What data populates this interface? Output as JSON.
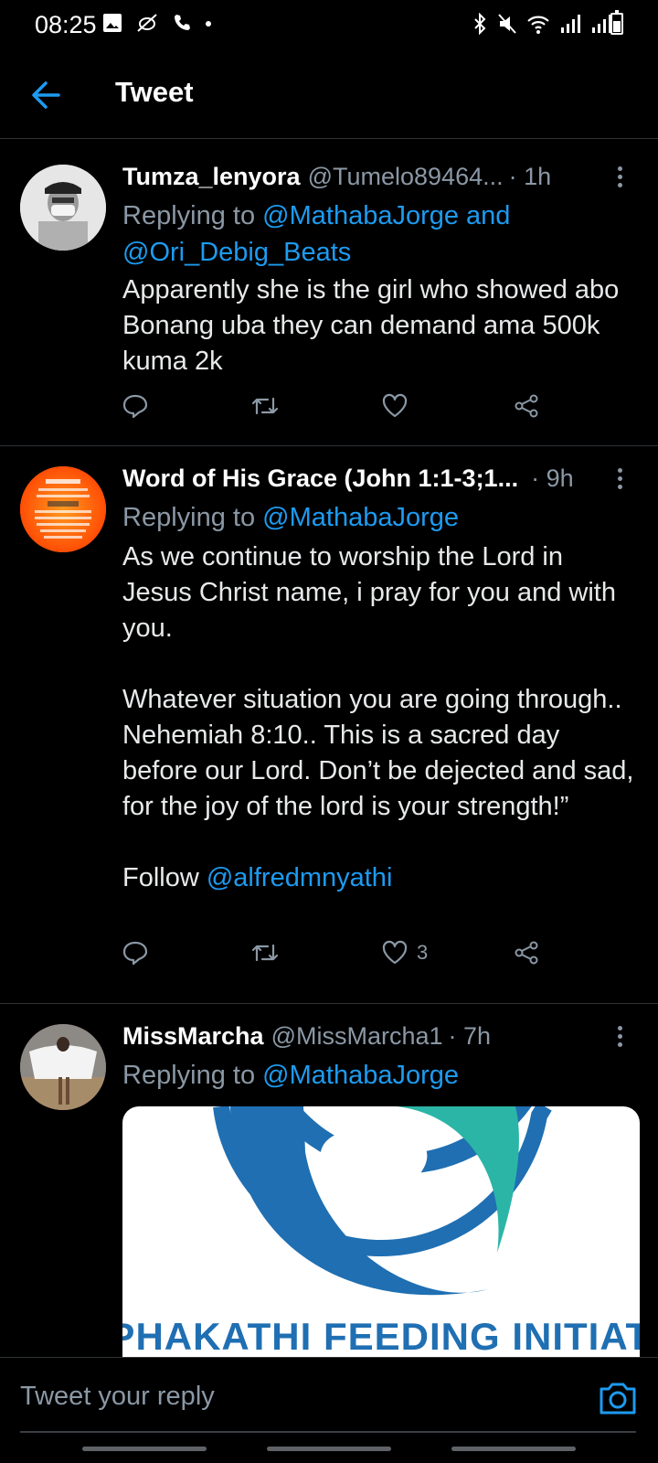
{
  "status_bar": {
    "time": "08:25"
  },
  "header": {
    "title": "Tweet"
  },
  "tweets": [
    {
      "name": "Tumza_lenyora",
      "handle": "@Tumelo89464...",
      "time": "· 1h",
      "replying_prefix": "Replying to ",
      "replying_to": "@MathabaJorge and @Ori_Debig_Beats",
      "body": "Apparently she is the girl who showed abo Bonang uba they can demand ama 500k kuma 2k",
      "like_count": ""
    },
    {
      "name": "Word of His Grace (John 1:1-3;1...",
      "handle": "",
      "time": "· 9h",
      "replying_prefix": "Replying to ",
      "replying_to": "@MathabaJorge",
      "body": "As we continue to worship the Lord in Jesus Christ name, i pray for you and with you.\n\nWhatever situation you are going through.. Nehemiah 8:10.. This is a sacred day before our Lord. Don’t be dejected and sad, for the joy of the lord is your strength!”\n\n",
      "body_follow_prefix": "Follow ",
      "body_follow_mention": "@alfredmnyathi",
      "like_count": "3"
    },
    {
      "name": "MissMarcha",
      "handle": "@MissMarcha1",
      "time": "· 7h",
      "replying_prefix": "Replying to ",
      "replying_to": "@MathabaJorge",
      "media_text": "UMPHAKATHI FEEDING INITIATIVE"
    }
  ],
  "reply_bar": {
    "placeholder": "Tweet your reply"
  },
  "colors": {
    "accent": "#1d9bf0",
    "muted": "#8b98a5",
    "background": "#000000"
  }
}
